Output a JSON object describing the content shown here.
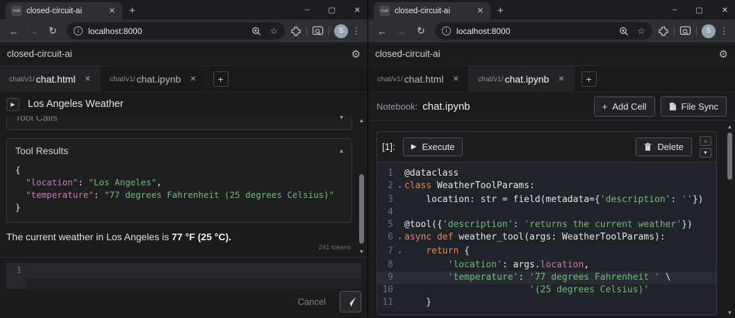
{
  "colors": {
    "kw": "#de8a5e",
    "str": "#74ba7c",
    "prop": "#c77fb5",
    "plain": "#e8e8e8",
    "lnum": "#6d7178"
  },
  "browser": {
    "tab_title": "closed-circuit-ai",
    "favicon_text": "ccai",
    "url": "localhost:8000",
    "avatar_letter": "S",
    "minimize": "–",
    "maximize": "▢",
    "close": "✕",
    "back": "←",
    "forward": "→",
    "reload": "↻",
    "info": "i",
    "star": "☆",
    "kebab": "⋮",
    "tab_close": "✕",
    "new_tab": "+"
  },
  "app": {
    "title": "closed-circuit-ai",
    "gear": "⚙",
    "tabs": [
      {
        "prefix": "chat/v1/",
        "name": "chat.html",
        "close": "✕"
      },
      {
        "prefix": "chat/v1/",
        "name": "chat.ipynb",
        "close": "✕"
      }
    ],
    "tab_add": "+"
  },
  "chat": {
    "conversation_title": "Los Angeles Weather",
    "conv_toggle": "▶",
    "tool_calls_label": "Tool Calls",
    "tool_calls_caret": "▾",
    "tool_results_label": "Tool Results",
    "tool_results_caret": "▴",
    "tool_results_json": [
      {
        "tokens": [
          {
            "c": "plain",
            "t": "{"
          }
        ]
      },
      {
        "tokens": [
          {
            "c": "plain",
            "t": "  "
          },
          {
            "c": "prop",
            "t": "\"location\""
          },
          {
            "c": "plain",
            "t": ": "
          },
          {
            "c": "str",
            "t": "\"Los Angeles\""
          },
          {
            "c": "plain",
            "t": ","
          }
        ]
      },
      {
        "tokens": [
          {
            "c": "plain",
            "t": "  "
          },
          {
            "c": "prop",
            "t": "\"temperature\""
          },
          {
            "c": "plain",
            "t": ": "
          },
          {
            "c": "str",
            "t": "\"77 degrees Fahrenheit (25 degrees Celsius)\""
          }
        ]
      },
      {
        "tokens": [
          {
            "c": "plain",
            "t": "}"
          }
        ]
      }
    ],
    "assistant_text_prefix": "The current weather in Los Angeles is ",
    "assistant_text_bold": "77 °F (25 °C).",
    "token_count": "241 tokens",
    "input_line_number": "1",
    "cancel_label": "Cancel"
  },
  "notebook": {
    "label": "Notebook:",
    "filename": "chat.ipynb",
    "add_cell_plus": "+",
    "add_cell_label": "Add Cell",
    "file_sync_label": "File Sync",
    "cell": {
      "index_label": "[1]:",
      "execute_play": "▶",
      "execute_label": "Execute",
      "delete_label": "Delete",
      "move_up": "▲",
      "move_down": "▼"
    },
    "code": [
      {
        "n": "1",
        "tokens": [
          {
            "c": "plain",
            "t": "@dataclass"
          }
        ]
      },
      {
        "n": "2",
        "fold": true,
        "tokens": [
          {
            "c": "kw",
            "t": "class"
          },
          {
            "c": "plain",
            "t": " WeatherToolParams:"
          }
        ]
      },
      {
        "n": "3",
        "tokens": [
          {
            "c": "plain",
            "t": "    location: str = field(metadata={"
          },
          {
            "c": "str",
            "t": "'description'"
          },
          {
            "c": "plain",
            "t": ": "
          },
          {
            "c": "str",
            "t": "''"
          },
          {
            "c": "plain",
            "t": "})"
          }
        ]
      },
      {
        "n": "4",
        "tokens": []
      },
      {
        "n": "5",
        "tokens": [
          {
            "c": "plain",
            "t": "@tool({"
          },
          {
            "c": "str",
            "t": "'description'"
          },
          {
            "c": "plain",
            "t": ": "
          },
          {
            "c": "str",
            "t": "'returns the current weather'"
          },
          {
            "c": "plain",
            "t": "})"
          }
        ]
      },
      {
        "n": "6",
        "fold": true,
        "tokens": [
          {
            "c": "kw",
            "t": "async def"
          },
          {
            "c": "plain",
            "t": " weather_tool(args: WeatherToolParams):"
          }
        ]
      },
      {
        "n": "7",
        "fold": true,
        "tokens": [
          {
            "c": "plain",
            "t": "    "
          },
          {
            "c": "kw",
            "t": "return"
          },
          {
            "c": "plain",
            "t": " {"
          }
        ]
      },
      {
        "n": "8",
        "tokens": [
          {
            "c": "plain",
            "t": "        "
          },
          {
            "c": "str",
            "t": "'location'"
          },
          {
            "c": "plain",
            "t": ": args."
          },
          {
            "c": "prop",
            "t": "location"
          },
          {
            "c": "plain",
            "t": ","
          }
        ]
      },
      {
        "n": "9",
        "active": true,
        "tokens": [
          {
            "c": "plain",
            "t": "        "
          },
          {
            "c": "str",
            "t": "'temperature'"
          },
          {
            "c": "plain",
            "t": ": "
          },
          {
            "c": "str",
            "t": "'77 degrees Fahrenheit '"
          },
          {
            "c": "plain",
            "t": " \\"
          }
        ]
      },
      {
        "n": "10",
        "tokens": [
          {
            "c": "plain",
            "t": "                       "
          },
          {
            "c": "str",
            "t": "'(25 degrees Celsius)'"
          }
        ]
      },
      {
        "n": "11",
        "tokens": [
          {
            "c": "plain",
            "t": "    }"
          }
        ]
      }
    ]
  }
}
